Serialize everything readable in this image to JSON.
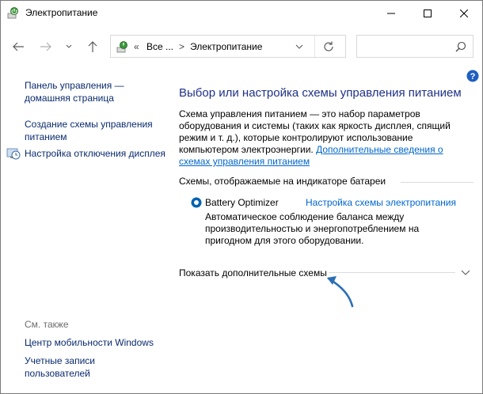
{
  "window": {
    "title": "Электропитание"
  },
  "address": {
    "overflow": "«",
    "crumb_all": "Все ...",
    "separator": ">",
    "current": "Электропитание"
  },
  "search": {
    "placeholder": ""
  },
  "sidebar": {
    "links": [
      {
        "label": "Панель управления — домашняя страница"
      },
      {
        "label": "Создание схемы управления питанием"
      },
      {
        "label": "Настройка отключения дисплея",
        "icon": "clock-monitor-icon"
      }
    ],
    "see_also": {
      "title": "См. также",
      "links": [
        {
          "label": "Центр мобильности Windows"
        },
        {
          "label": "Учетные записи пользователей"
        }
      ]
    }
  },
  "main": {
    "title": "Выбор или настройка схемы управления питанием",
    "description": "Схема управления питанием — это набор параметров оборудования и системы (таких как яркость дисплея, спящий режим и т. д.), которые контролируют использование компьютером электроэнергии.",
    "more_info_link": "Дополнительные сведения о схемах управления питанием",
    "battery_section_title": "Схемы, отображаемые на индикаторе батареи",
    "plan": {
      "name": "Battery Optimizer",
      "settings_link": "Настройка схемы электропитания",
      "description": "Автоматическое соблюдение баланса между производительностью и энергопотреблением на пригодном для этого оборудовании.",
      "selected": true
    },
    "show_more": "Показать дополнительные схемы"
  },
  "colors": {
    "title_blue": "#1e3287",
    "link_blue": "#0066cc",
    "nav_link": "#0a2b6e",
    "radio_blue": "#0063b1",
    "annotation_arrow": "#2b6fb5"
  }
}
